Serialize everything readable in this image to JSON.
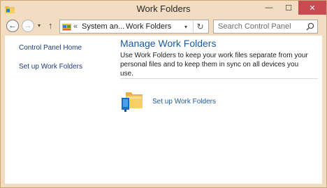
{
  "window": {
    "title": "Work Folders",
    "caption": {
      "minimize": "—",
      "maximize": "☐",
      "close": "✕"
    }
  },
  "navigation": {
    "back": "←",
    "forward": "→",
    "recent_dropdown": "▾",
    "up": "↑"
  },
  "address": {
    "chevrons": "«",
    "crumbs": [
      "System an...",
      "Work Folders"
    ],
    "separator": "›",
    "dropdown": "▾",
    "refresh": "↻"
  },
  "search": {
    "placeholder": "Search Control Panel",
    "value": ""
  },
  "sidebar": {
    "items": [
      {
        "label": "Control Panel Home"
      },
      {
        "label": "Set up Work Folders"
      }
    ]
  },
  "main": {
    "heading": "Manage Work Folders",
    "description": "Use Work Folders to keep your work files separate from your personal files and to keep them in sync on all devices you use.",
    "task": {
      "label": "Set up Work Folders"
    }
  },
  "colors": {
    "frame": "#f2dcc0",
    "close_button": "#c74b50",
    "heading": "#1c5a9f",
    "link": "#1c5a9f"
  }
}
